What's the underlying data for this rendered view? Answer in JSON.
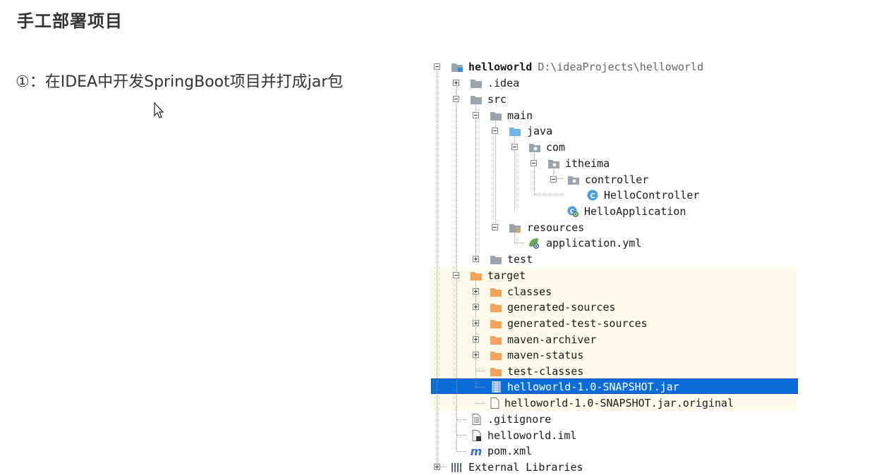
{
  "slide": {
    "title": "手工部署项目",
    "step": "①：在IDEA中开发SpringBoot项目并打成jar包"
  },
  "tree": {
    "root_name": "helloworld",
    "root_path": "D:\\ideaProjects\\helloworld",
    "items": {
      "idea": ".idea",
      "src": "src",
      "main": "main",
      "java": "java",
      "com": "com",
      "itheima": "itheima",
      "controller": "controller",
      "hello_controller": "HelloController",
      "hello_application": "HelloApplication",
      "resources": "resources",
      "application_yml": "application.yml",
      "test": "test",
      "target": "target",
      "classes": "classes",
      "generated_sources": "generated-sources",
      "generated_test_sources": "generated-test-sources",
      "maven_archiver": "maven-archiver",
      "maven_status": "maven-status",
      "test_classes": "test-classes",
      "jar": "helloworld-1.0-SNAPSHOT.jar",
      "jar_original": "helloworld-1.0-SNAPSHOT.jar.original",
      "gitignore": ".gitignore",
      "iml": "helloworld.iml",
      "pom": "pom.xml",
      "external_libraries": "External Libraries"
    },
    "selected_item": "helloworld-1.0-SNAPSHOT.jar"
  },
  "colors": {
    "selection": "#0a6dd9",
    "target_highlight": "#fdfbeb",
    "folder_gray": "#9aa3b0",
    "folder_blue": "#6fb5ea",
    "folder_orange": "#f5a35a"
  }
}
